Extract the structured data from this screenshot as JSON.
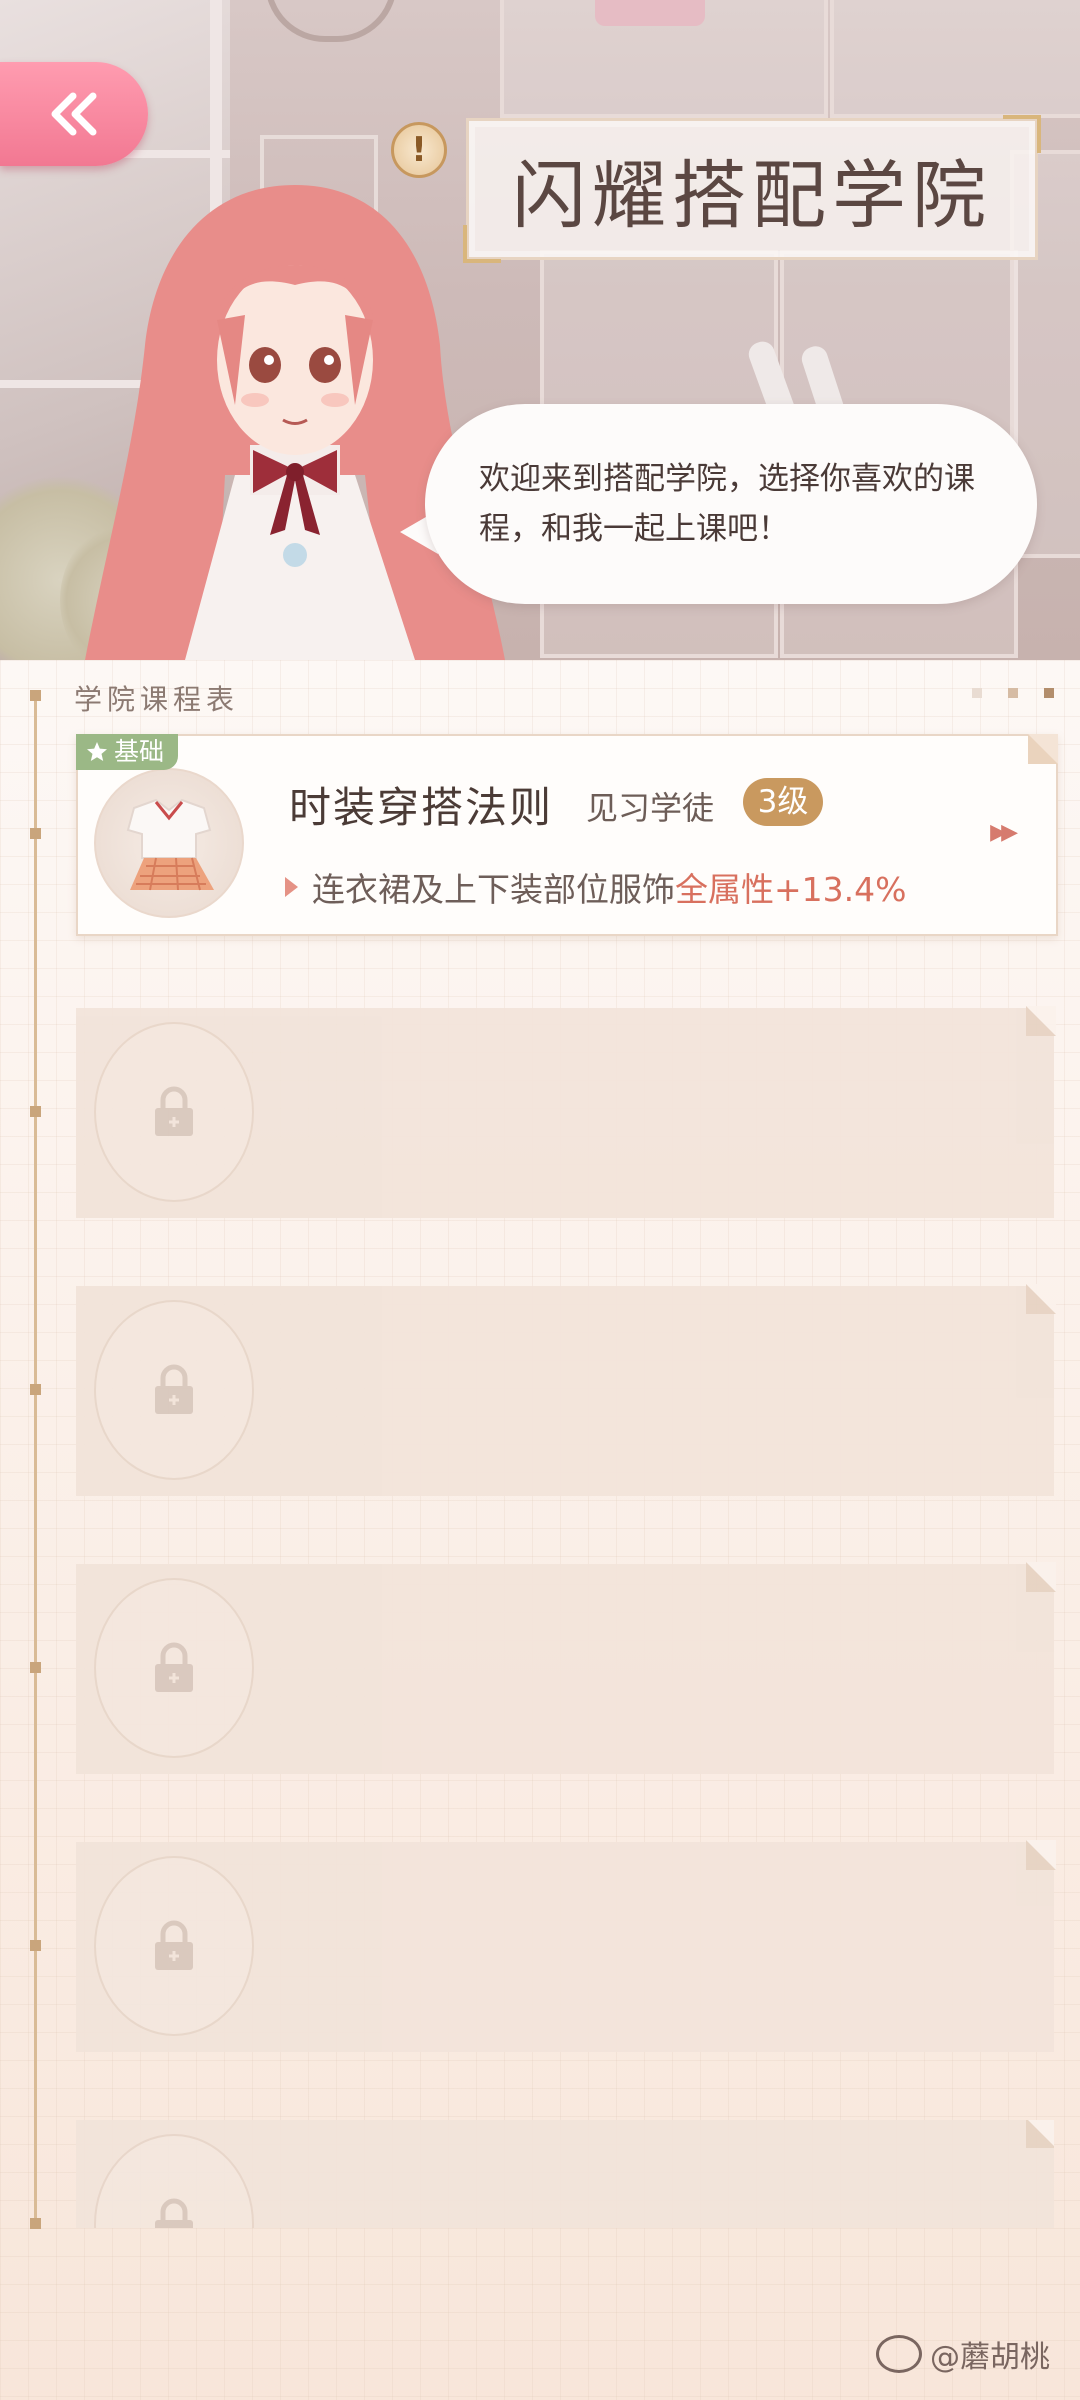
{
  "header": {
    "title": "闪耀搭配学院",
    "dialogue": "欢迎来到搭配学院，选择你喜欢的课程，和我一起上课吧！"
  },
  "schedule": {
    "label": "学院课程表",
    "courses": [
      {
        "tier": "基础",
        "title": "时装穿搭法则",
        "rank": "见习学徒",
        "level": "3级",
        "effect_prefix": "连衣裙及上下装部位服饰",
        "effect_highlight": "全属性+13.4%",
        "locked": false
      },
      {
        "locked": true
      },
      {
        "locked": true
      },
      {
        "locked": true
      },
      {
        "locked": true
      },
      {
        "locked": true
      }
    ]
  },
  "watermark": "@蘑胡桃",
  "colors": {
    "back_button": "#f27892",
    "tier_badge": "#9bb886",
    "level_badge": "#c9995f",
    "effect_highlight": "#d8705e"
  },
  "icons": [
    "back-chevron-icon",
    "info-icon",
    "star-icon",
    "lock-icon",
    "forward-chevron-icon",
    "weibo-logo-icon"
  ]
}
